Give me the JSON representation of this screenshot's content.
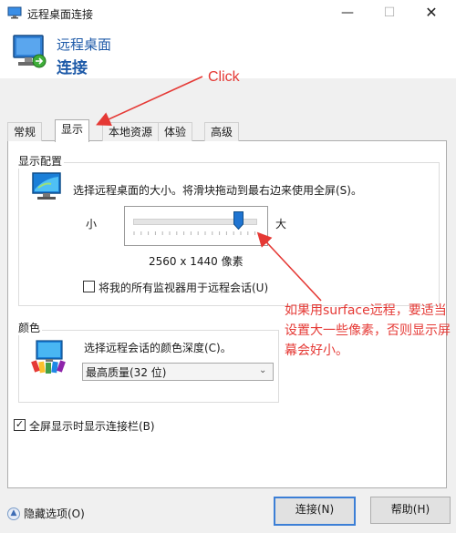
{
  "window": {
    "title": "远程桌面连接",
    "controls": {
      "minimize": "—",
      "maximize": "☐",
      "close": "✕"
    }
  },
  "header": {
    "line1": "远程桌面",
    "line2": "连接"
  },
  "tabs": [
    {
      "label": "常规"
    },
    {
      "label": "显示",
      "active": true
    },
    {
      "label": "本地资源"
    },
    {
      "label": "体验"
    },
    {
      "label": "高级"
    }
  ],
  "display_config": {
    "group_label": "显示配置",
    "description": "选择远程桌面的大小。将滑块拖动到最右边来使用全屏(S)。",
    "slider": {
      "min_label": "小",
      "max_label": "大",
      "position": 0.85
    },
    "resolution": "2560 x 1440 像素",
    "multimon_label": "将我的所有监视器用于远程会话(U)",
    "multimon_checked": false
  },
  "colors": {
    "group_label": "颜色",
    "description": "选择远程会话的颜色深度(C)。",
    "selected_depth": "最高质量(32 位)"
  },
  "connection_bar": {
    "label": "全屏显示时显示连接栏(B)",
    "checked": true,
    "mark": "✓"
  },
  "footer": {
    "hide_options": "隐藏选项(O)",
    "connect_label": "连接(N)",
    "help_label": "帮助(H)"
  },
  "annotations": {
    "click": "Click",
    "note": "如果用surface远程，要适当设置大一些像素，否则显示屏幕会好小。",
    "color": "#e53935"
  },
  "colors_theme": {
    "accent": "#1e5aa8",
    "focus": "#3c7fd6"
  }
}
